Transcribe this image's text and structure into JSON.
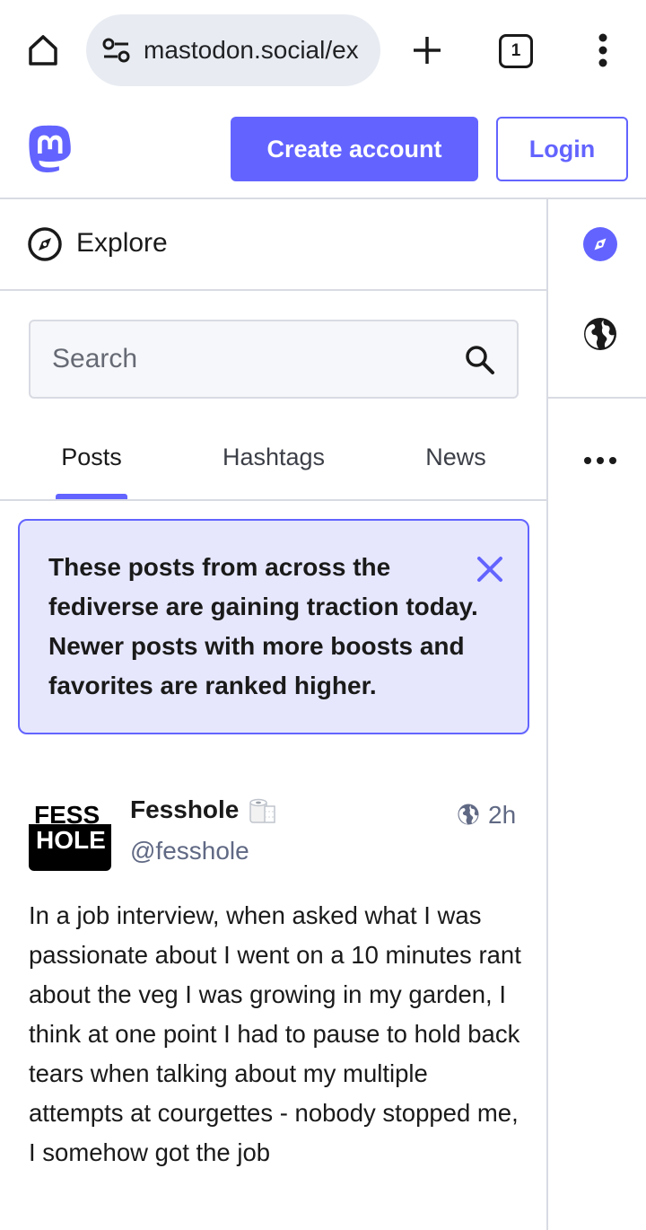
{
  "browser": {
    "url": "mastodon.social/ex",
    "tab_count": "1",
    "icons": [
      "home-icon",
      "site-settings-icon",
      "plus-icon",
      "tab-count-icon",
      "more-vert-icon"
    ]
  },
  "header": {
    "create_account_label": "Create account",
    "login_label": "Login",
    "brand_color": "#6364ff"
  },
  "column": {
    "title": "Explore",
    "search_placeholder": "Search",
    "tabs": [
      {
        "label": "Posts",
        "active": true
      },
      {
        "label": "Hashtags",
        "active": false
      },
      {
        "label": "News",
        "active": false
      }
    ],
    "notice": "These posts from across the fediverse are gaining traction today. Newer posts with more boosts and favorites are ranked higher."
  },
  "post": {
    "avatar_top": "FESS",
    "avatar_bottom": "HOLE",
    "display_name": "Fesshole",
    "name_emoji": "toilet-paper-icon",
    "handle": "@fesshole",
    "time": "2h",
    "visibility": "public-globe-icon",
    "body": "In a job interview, when asked what I was passionate about I went on a 10 minutes rant about the veg I was growing in my garden, I think at one point I had to pause to hold back tears when talking about my multiple attempts at courgettes - nobody stopped me, I somehow got the job"
  },
  "right_nav": {
    "items": [
      "explore-icon",
      "globe-icon",
      "more-icon"
    ],
    "active": "explore-icon"
  }
}
